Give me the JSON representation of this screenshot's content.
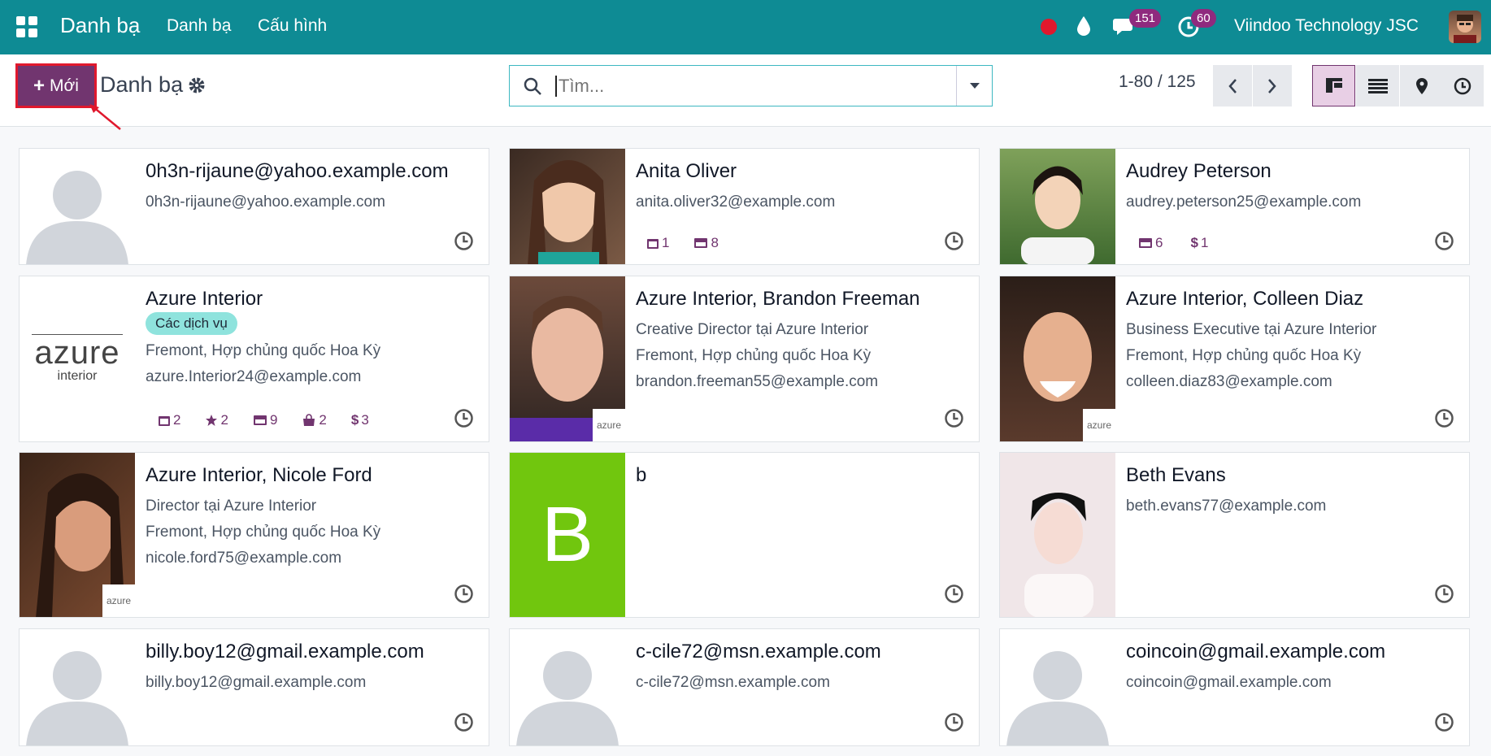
{
  "navbar": {
    "brand": "Danh bạ",
    "menu": [
      "Danh bạ",
      "Cấu hình"
    ],
    "messages_count": "151",
    "activities_count": "60",
    "company": "Viindoo Technology JSC"
  },
  "control": {
    "new_label": "Mới",
    "breadcrumb": "Danh bạ",
    "search_placeholder": "Tìm...",
    "pager": "1-80 / 125"
  },
  "colors": {
    "navbar": "#0e8b94",
    "primary": "#71356f",
    "badge": "#8f2a7e",
    "tag": "#8fe3dd"
  },
  "cards": [
    {
      "name": "0h3n-rijaune@yahoo.example.com",
      "lines": [
        "0h3n-rijaune@yahoo.example.com"
      ]
    },
    {
      "name": "Anita Oliver",
      "lines": [
        "anita.oliver32@example.com"
      ],
      "stats": [
        "1",
        "8"
      ]
    },
    {
      "name": "Audrey Peterson",
      "lines": [
        "audrey.peterson25@example.com"
      ],
      "stats": [
        "6",
        "1"
      ]
    },
    {
      "name": "Azure Interior",
      "tag": "Các dịch vụ",
      "lines": [
        "Fremont, Hợp chủng quốc Hoa Kỳ",
        "azure.Interior24@example.com"
      ],
      "stats": [
        "2",
        "2",
        "9",
        "2",
        "3"
      ],
      "logo_text": "azure",
      "logo_sub": "interior"
    },
    {
      "name": "Azure Interior, Brandon Freeman",
      "lines": [
        "Creative Director tại Azure Interior",
        "Fremont, Hợp chủng quốc Hoa Kỳ",
        "brandon.freeman55@example.com"
      ]
    },
    {
      "name": "Azure Interior, Colleen Diaz",
      "lines": [
        "Business Executive tại Azure Interior",
        "Fremont, Hợp chủng quốc Hoa Kỳ",
        "colleen.diaz83@example.com"
      ]
    },
    {
      "name": "Azure Interior, Nicole Ford",
      "lines": [
        "Director tại Azure Interior",
        "Fremont, Hợp chủng quốc Hoa Kỳ",
        "nicole.ford75@example.com"
      ]
    },
    {
      "name": "b",
      "lines": [],
      "initial": "B"
    },
    {
      "name": "Beth Evans",
      "lines": [
        "beth.evans77@example.com"
      ]
    },
    {
      "name": "billy.boy12@gmail.example.com",
      "lines": [
        "billy.boy12@gmail.example.com"
      ]
    },
    {
      "name": "c-cile72@msn.example.com",
      "lines": [
        "c-cile72@msn.example.com"
      ]
    },
    {
      "name": "coincoin@gmail.example.com",
      "lines": [
        "coincoin@gmail.example.com"
      ]
    }
  ]
}
